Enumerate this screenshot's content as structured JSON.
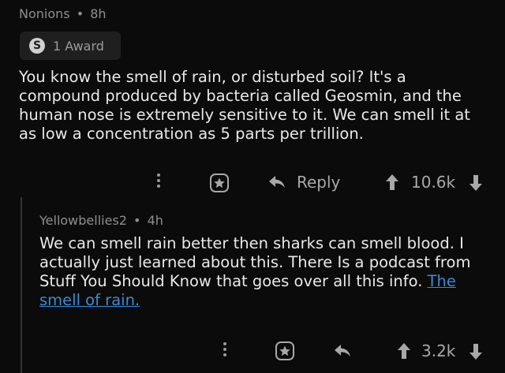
{
  "comment1": {
    "author": "Nonions",
    "separator": "•",
    "time": "8h",
    "award_label": "1 Award",
    "award_icon": "silver-award-icon",
    "body_lines": [
      "You know the smell of rain, or disturbed soil? It's a",
      "compound produced by bacteria called Geosmin, and the",
      "human nose is extremely sensitive to it. We can smell it at",
      "as low a concentration as 5 parts per trillion."
    ],
    "reply_label": "Reply",
    "vote_count": "10.6k"
  },
  "comment2": {
    "author": "Yellowbellies2",
    "separator": "•",
    "time": "4h",
    "body_lines": [
      "We can smell rain better then sharks can smell blood. I",
      "actually just learned about this. There Is a podcast from",
      "Stuff You Should Know that goes over all this info. "
    ],
    "link_line1": "The",
    "link_line2": "smell of rain.",
    "vote_count": "3.2k"
  },
  "colors": {
    "background": "#0b0b0b",
    "text": "#e9e9e9",
    "meta": "#8e8e8e",
    "link": "#3a8ad6"
  }
}
